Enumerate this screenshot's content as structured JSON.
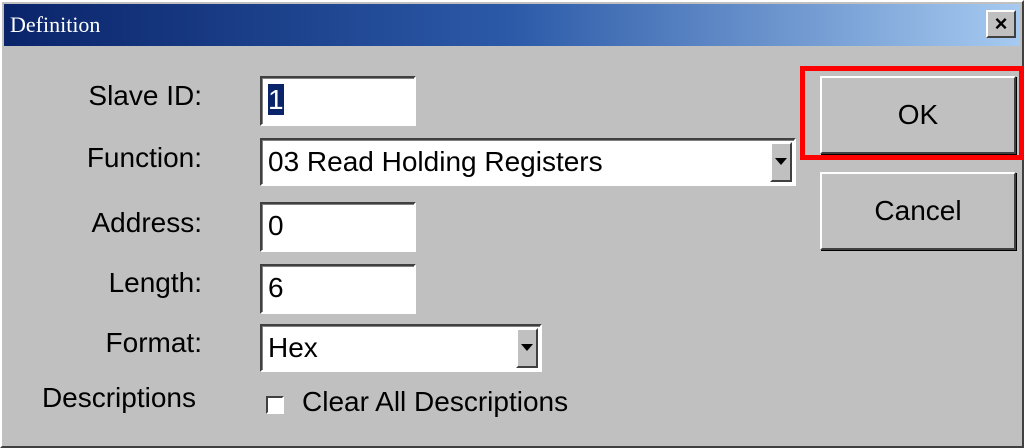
{
  "window": {
    "title": "Definition",
    "close_glyph": "×"
  },
  "form": {
    "slave_id": {
      "label": "Slave ID:",
      "value": "1"
    },
    "function": {
      "label": "Function:",
      "value": "03 Read Holding Registers"
    },
    "address": {
      "label": "Address:",
      "value": "0"
    },
    "length": {
      "label": "Length:",
      "value": "6"
    },
    "format": {
      "label": "Format:",
      "value": "Hex"
    },
    "descriptions": {
      "label": "Descriptions",
      "checkbox_label": "Clear All Descriptions",
      "checked": false
    }
  },
  "buttons": {
    "ok": "OK",
    "cancel": "Cancel"
  },
  "annotation": {
    "highlight_target": "ok-button",
    "color": "#ff0000"
  },
  "icons": [
    "close-icon",
    "dropdown-arrow-icon",
    "checkbox-icon"
  ]
}
